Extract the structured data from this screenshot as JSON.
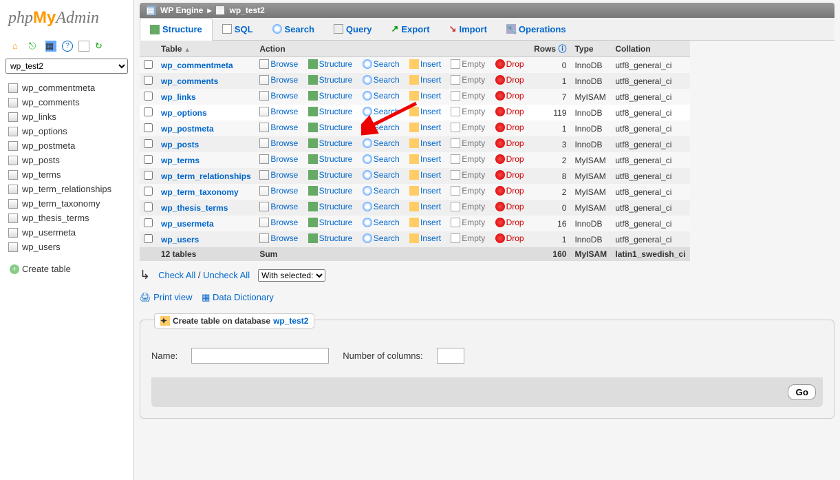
{
  "logo": {
    "php": "php",
    "my": "My",
    "admin": "Admin"
  },
  "sidebar": {
    "selected_db": "wp_test2",
    "tables": [
      "wp_commentmeta",
      "wp_comments",
      "wp_links",
      "wp_options",
      "wp_postmeta",
      "wp_posts",
      "wp_terms",
      "wp_term_relationships",
      "wp_term_taxonomy",
      "wp_thesis_terms",
      "wp_usermeta",
      "wp_users"
    ],
    "create_table": "Create table"
  },
  "breadcrumb": {
    "server": "WP Engine",
    "db": "wp_test2"
  },
  "tabs": [
    "Structure",
    "SQL",
    "Search",
    "Query",
    "Export",
    "Import",
    "Operations"
  ],
  "cols": {
    "table": "Table",
    "action": "Action",
    "rows": "Rows",
    "type": "Type",
    "collation": "Collation"
  },
  "actions": {
    "browse": "Browse",
    "structure": "Structure",
    "search": "Search",
    "insert": "Insert",
    "empty": "Empty",
    "drop": "Drop"
  },
  "rows": [
    {
      "name": "wp_commentmeta",
      "rows": "0",
      "type": "InnoDB",
      "collation": "utf8_general_ci"
    },
    {
      "name": "wp_comments",
      "rows": "1",
      "type": "InnoDB",
      "collation": "utf8_general_ci"
    },
    {
      "name": "wp_links",
      "rows": "7",
      "type": "MyISAM",
      "collation": "utf8_general_ci"
    },
    {
      "name": "wp_options",
      "rows": "119",
      "type": "InnoDB",
      "collation": "utf8_general_ci",
      "hl": true
    },
    {
      "name": "wp_postmeta",
      "rows": "1",
      "type": "InnoDB",
      "collation": "utf8_general_ci"
    },
    {
      "name": "wp_posts",
      "rows": "3",
      "type": "InnoDB",
      "collation": "utf8_general_ci"
    },
    {
      "name": "wp_terms",
      "rows": "2",
      "type": "MyISAM",
      "collation": "utf8_general_ci"
    },
    {
      "name": "wp_term_relationships",
      "rows": "8",
      "type": "MyISAM",
      "collation": "utf8_general_ci"
    },
    {
      "name": "wp_term_taxonomy",
      "rows": "2",
      "type": "MyISAM",
      "collation": "utf8_general_ci"
    },
    {
      "name": "wp_thesis_terms",
      "rows": "0",
      "type": "MyISAM",
      "collation": "utf8_general_ci"
    },
    {
      "name": "wp_usermeta",
      "rows": "16",
      "type": "InnoDB",
      "collation": "utf8_general_ci"
    },
    {
      "name": "wp_users",
      "rows": "1",
      "type": "InnoDB",
      "collation": "utf8_general_ci"
    }
  ],
  "sum": {
    "label": "12 tables",
    "action": "Sum",
    "rows": "160",
    "type": "MyISAM",
    "collation": "latin1_swedish_ci"
  },
  "footer": {
    "check_all": "Check All",
    "uncheck_all": "Uncheck All",
    "with_selected": "With selected:"
  },
  "links": {
    "print_view": "Print view",
    "data_dict": "Data Dictionary",
    "sep": " / "
  },
  "create": {
    "title_prefix": "Create table on database ",
    "db": "wp_test2",
    "name": "Name:",
    "cols": "Number of columns:",
    "go": "Go"
  }
}
